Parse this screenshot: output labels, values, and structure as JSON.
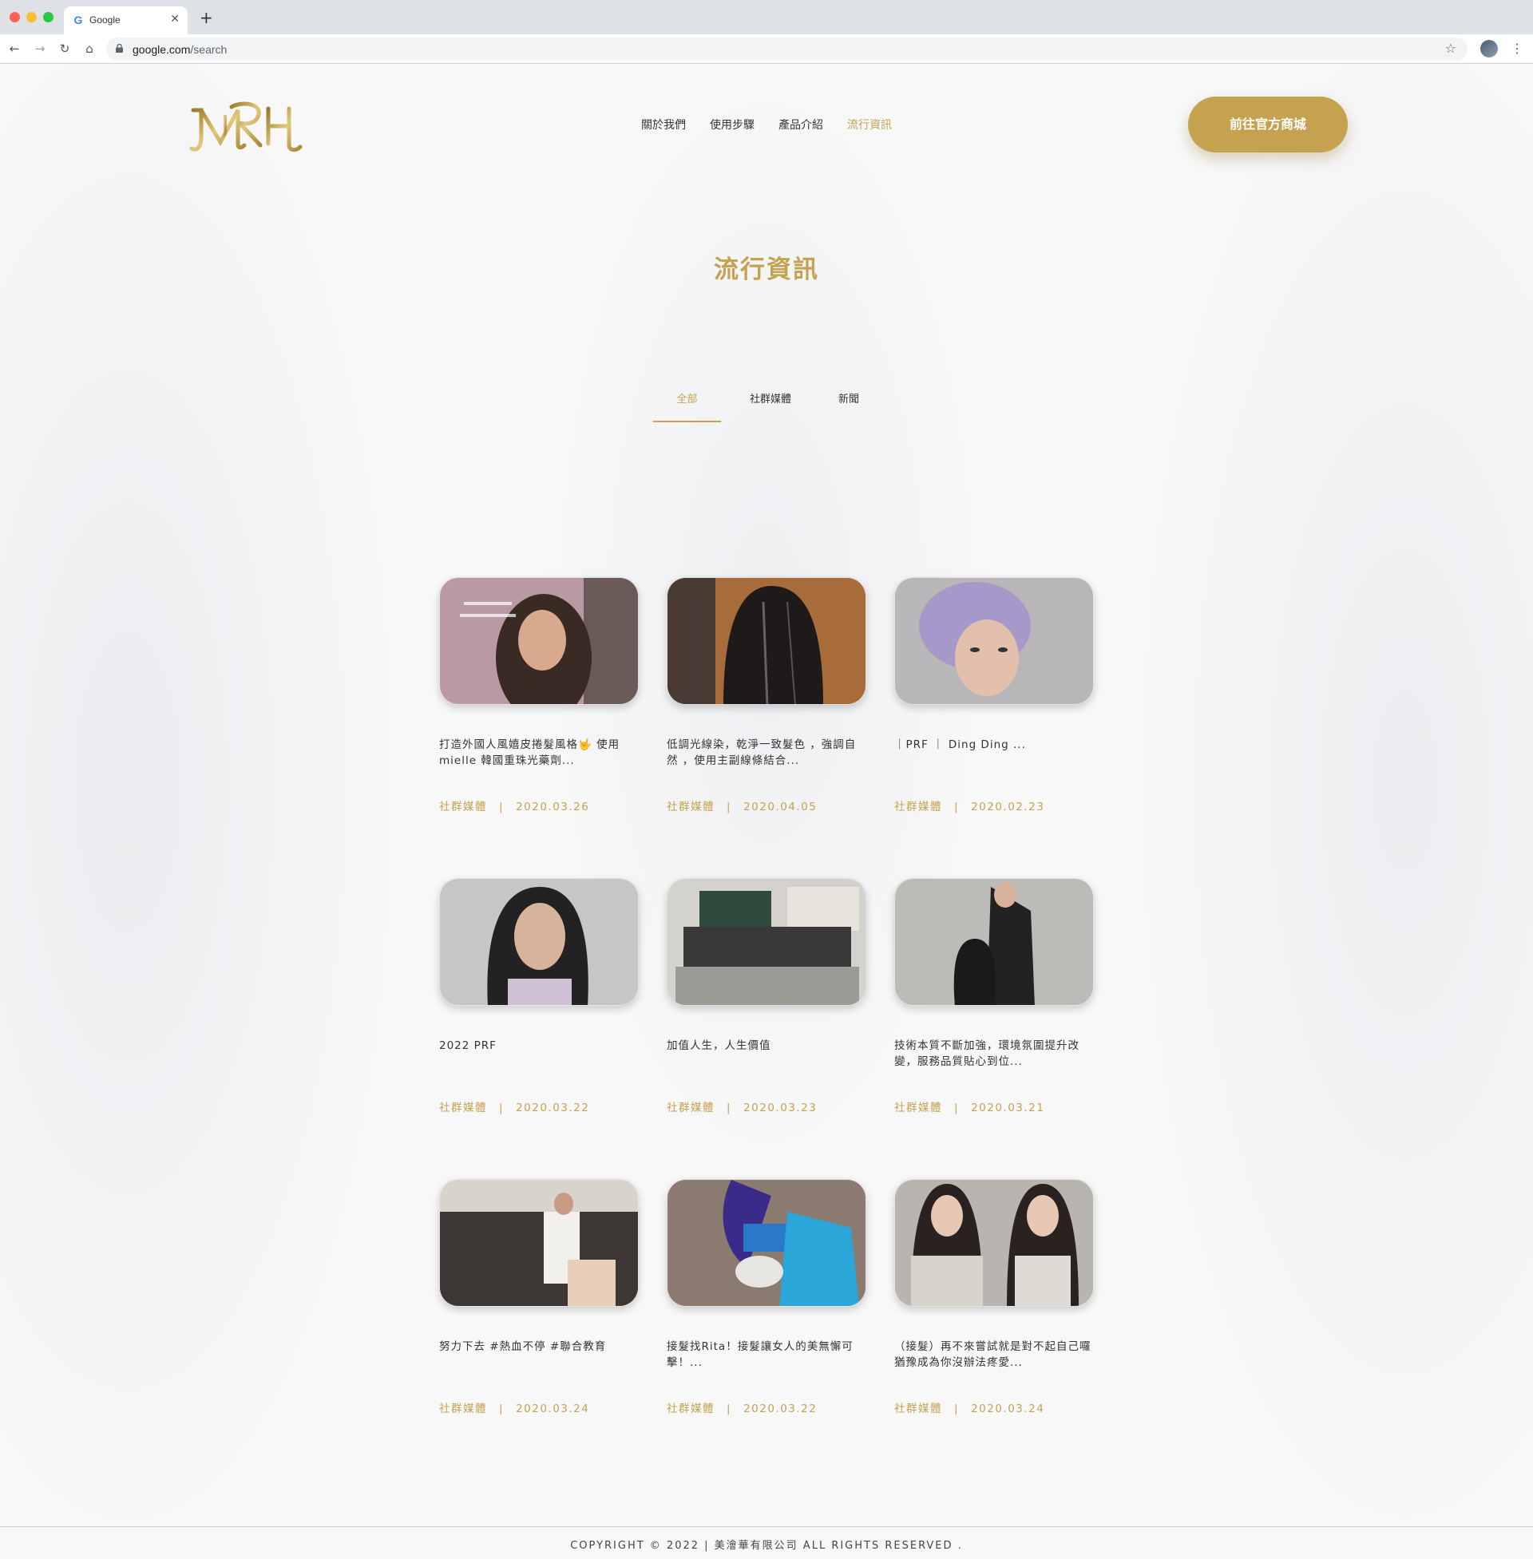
{
  "browser": {
    "tab_title": "Google",
    "tab_favicon": "G",
    "url_host": "google.com",
    "url_path": "/search"
  },
  "site": {
    "logo_text": "MRH",
    "nav": [
      {
        "label": "關於我們"
      },
      {
        "label": "使用步驟"
      },
      {
        "label": "產品介紹"
      },
      {
        "label": "流行資訊"
      }
    ],
    "nav_active_index": 3,
    "shop_button": "前往官方商城",
    "page_title": "流行資訊",
    "filter_tabs": [
      {
        "label": "全部"
      },
      {
        "label": "社群媒體"
      },
      {
        "label": "新聞"
      }
    ],
    "filter_active_index": 0,
    "posts": [
      {
        "text": "打造外國人風嬉皮捲髮風格🤟 使用mielle 韓國重珠光藥劑...",
        "category": "社群媒體",
        "date": "2020.03.26"
      },
      {
        "text": "低調光線染，乾淨一致髮色 ，強調自然 ，使用主副線條結合...",
        "category": "社群媒體",
        "date": "2020.04.05"
      },
      {
        "text": "｜PRF ｜ Ding Ding ...",
        "category": "社群媒體",
        "date": "2020.02.23"
      },
      {
        "text": "2022 PRF",
        "category": "社群媒體",
        "date": "2020.03.22"
      },
      {
        "text": "加值人生，人生價值",
        "category": "社群媒體",
        "date": "2020.03.23"
      },
      {
        "text": "技術本質不斷加強，環境氛圍提升改變，服務品質貼心到位...",
        "category": "社群媒體",
        "date": "2020.03.21"
      },
      {
        "text": "努力下去 #熱血不停 #聯合教育",
        "category": "社群媒體",
        "date": "2020.03.24"
      },
      {
        "text": "接髮找Rita！接髮讓女人的美無懈可擊！...",
        "category": "社群媒體",
        "date": "2020.03.22"
      },
      {
        "text": "（接髮）再不來嘗試就是對不起自己囉 猶豫成為你沒辦法疼愛...",
        "category": "社群媒體",
        "date": "2020.03.24"
      }
    ],
    "meta_separator": "|",
    "footer": "COPYRIGHT © 2022 | 美澮華有限公司 ALL RIGHTS RESERVED ."
  },
  "colors": {
    "accent_gold": "#c4a24f",
    "text_dark": "#333333"
  }
}
